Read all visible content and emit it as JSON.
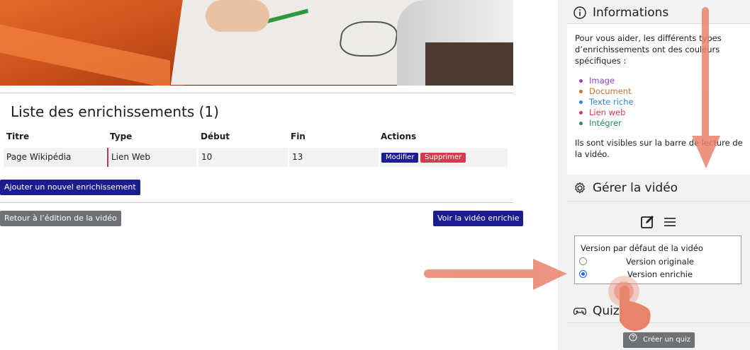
{
  "main": {
    "list_title": "Liste des enrichissements (1)",
    "table": {
      "headers": [
        "Titre",
        "Type",
        "Début",
        "Fin",
        "Actions"
      ],
      "rows": [
        {
          "titre": "Page Wikipédia",
          "type": "Lien Web",
          "debut": "10",
          "fin": "13",
          "modify_label": "Modifier",
          "delete_label": "Supprimer"
        }
      ]
    },
    "add_button": "Ajouter un nouvel enrichissement",
    "back_button": "Retour à l’édition de la vidéo",
    "view_button": "Voir la vidéo enrichie"
  },
  "sidebar": {
    "info": {
      "title": "Informations",
      "intro_line1": "Pour vous aider, les différents types",
      "intro_line2": "d’enrichissements ont des couleurs",
      "intro_line3": "spécifiques :",
      "legend": [
        {
          "label": "Image",
          "color": "#8e44c2"
        },
        {
          "label": "Document",
          "color": "#c9742a"
        },
        {
          "label": "Texte riche",
          "color": "#2a86d6"
        },
        {
          "label": "Lien web",
          "color": "#d63a4d"
        },
        {
          "label": "Intégrer",
          "color": "#2a8a5a"
        }
      ],
      "outro_line1": "Ils sont visibles sur la barre de lecture de",
      "outro_line2": "la vidéo."
    },
    "manage": {
      "title": "Gérer la vidéo",
      "default_version_label": "Version par défaut de la vidéo",
      "options": [
        {
          "label": "Version originale",
          "selected": false
        },
        {
          "label": "Version enrichie",
          "selected": true
        }
      ]
    },
    "quiz": {
      "title": "Quiz",
      "create_button": "Créer un quiz"
    }
  },
  "colors": {
    "accent_navy": "#1a1c90",
    "danger": "#d63a4d",
    "secondary": "#6e7276",
    "annotation_arrow": "#e8836c"
  }
}
